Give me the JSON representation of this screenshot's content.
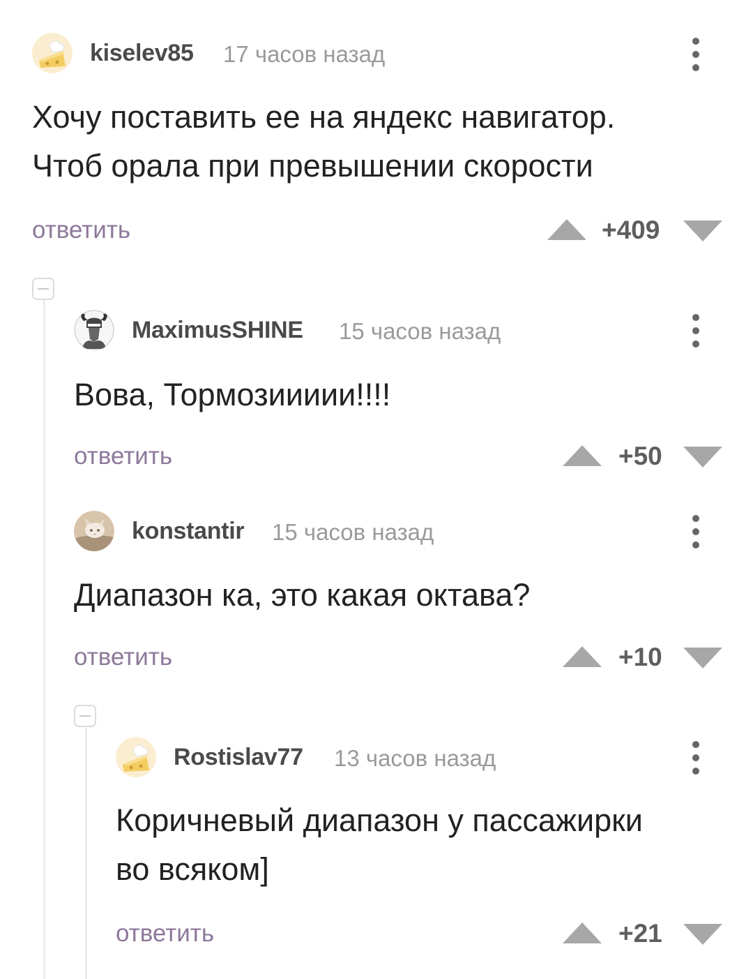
{
  "comments": [
    {
      "username": "kiselev85",
      "time": "17 часов назад",
      "lines": [
        "Хочу поставить ее на яндекс навигатор.",
        "Чтоб орала при превышении скорости"
      ],
      "reply": "ответить",
      "score": "+409",
      "avatar": "cheese-avatar-icon"
    },
    {
      "username": "MaximusSHINE",
      "time": "15 часов назад",
      "lines": [
        "Вова, Тормозиииии!!!!"
      ],
      "reply": "ответить",
      "score": "+50",
      "avatar": "helmet-avatar-icon"
    },
    {
      "username": "konstantir",
      "time": "15 часов назад",
      "lines": [
        "Диапазон ка, это какая октава?"
      ],
      "reply": "ответить",
      "score": "+10",
      "avatar": "cat-avatar-icon"
    },
    {
      "username": "Rostislav77",
      "time": "13 часов назад",
      "lines": [
        "Коричневый диапазон у пассажирки",
        "во всяком]"
      ],
      "reply": "ответить",
      "score": "+21",
      "avatar": "cheese-avatar-icon"
    }
  ],
  "colors": {
    "reply": "#8d789a",
    "score": "#5e5e5e",
    "vote_arrow": "#a7a7a7",
    "thread_line": "#ececec"
  }
}
